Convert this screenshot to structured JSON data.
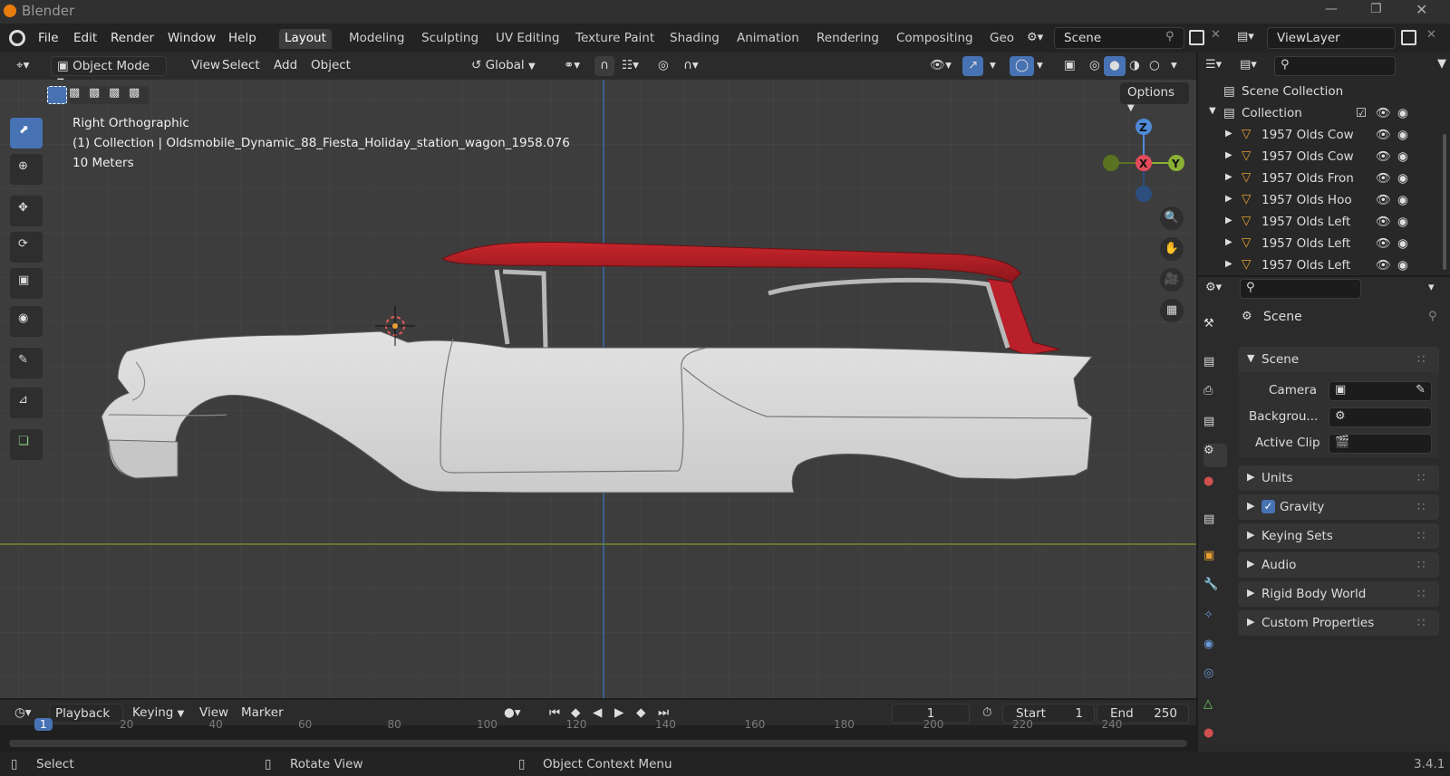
{
  "app": {
    "title": "Blender",
    "version": "3.4.1"
  },
  "menus": [
    "File",
    "Edit",
    "Render",
    "Window",
    "Help"
  ],
  "workspaces": [
    "Layout",
    "Modeling",
    "Sculpting",
    "UV Editing",
    "Texture Paint",
    "Shading",
    "Animation",
    "Rendering",
    "Compositing",
    "Geo"
  ],
  "active_workspace": "Layout",
  "scene_name": "Scene",
  "view_layer": "ViewLayer",
  "viewport_header": {
    "mode": "Object Mode",
    "view": "View",
    "select": "Select",
    "add": "Add",
    "object": "Object",
    "orientation": "Global",
    "options": "Options"
  },
  "overlay_text": {
    "view_name": "Right Orthographic",
    "collection_line": "(1) Collection | Oldsmobile_Dynamic_88_Fiesta_Holiday_station_wagon_1958.076",
    "scale": "10 Meters"
  },
  "gizmo": {
    "z": "Z",
    "x": "X",
    "y": "Y"
  },
  "timeline": {
    "playback": "Playback",
    "keying": "Keying",
    "view": "View",
    "marker": "Marker",
    "current_frame": "1",
    "start_label": "Start",
    "start": "1",
    "end_label": "End",
    "end": "250",
    "ticks": [
      "1",
      "20",
      "40",
      "60",
      "80",
      "100",
      "120",
      "140",
      "160",
      "180",
      "200",
      "220",
      "240"
    ]
  },
  "status": {
    "select": "Select",
    "rotate": "Rotate View",
    "context": "Object Context Menu"
  },
  "outliner": {
    "scene_collection": "Scene Collection",
    "collection": "Collection",
    "items": [
      "1957 Olds Cow",
      "1957 Olds Cow",
      "1957 Olds Fron",
      "1957 Olds Hoo",
      "1957 Olds Left",
      "1957 Olds Left",
      "1957 Olds Left"
    ]
  },
  "properties": {
    "context": "Scene",
    "panel": "Scene",
    "camera_label": "Camera",
    "background_label": "Backgrou...",
    "clip_label": "Active Clip",
    "sections": [
      "Units",
      "Gravity",
      "Keying Sets",
      "Audio",
      "Rigid Body World",
      "Custom Properties"
    ]
  },
  "colors": {
    "accent": "#4772b3",
    "x_axis": "#e34b5a",
    "y_axis": "#8ab033",
    "z_axis": "#4f8ad8",
    "roof": "#b01c22",
    "body": "#d6d6d6",
    "horizon": "#6f8a2a"
  }
}
